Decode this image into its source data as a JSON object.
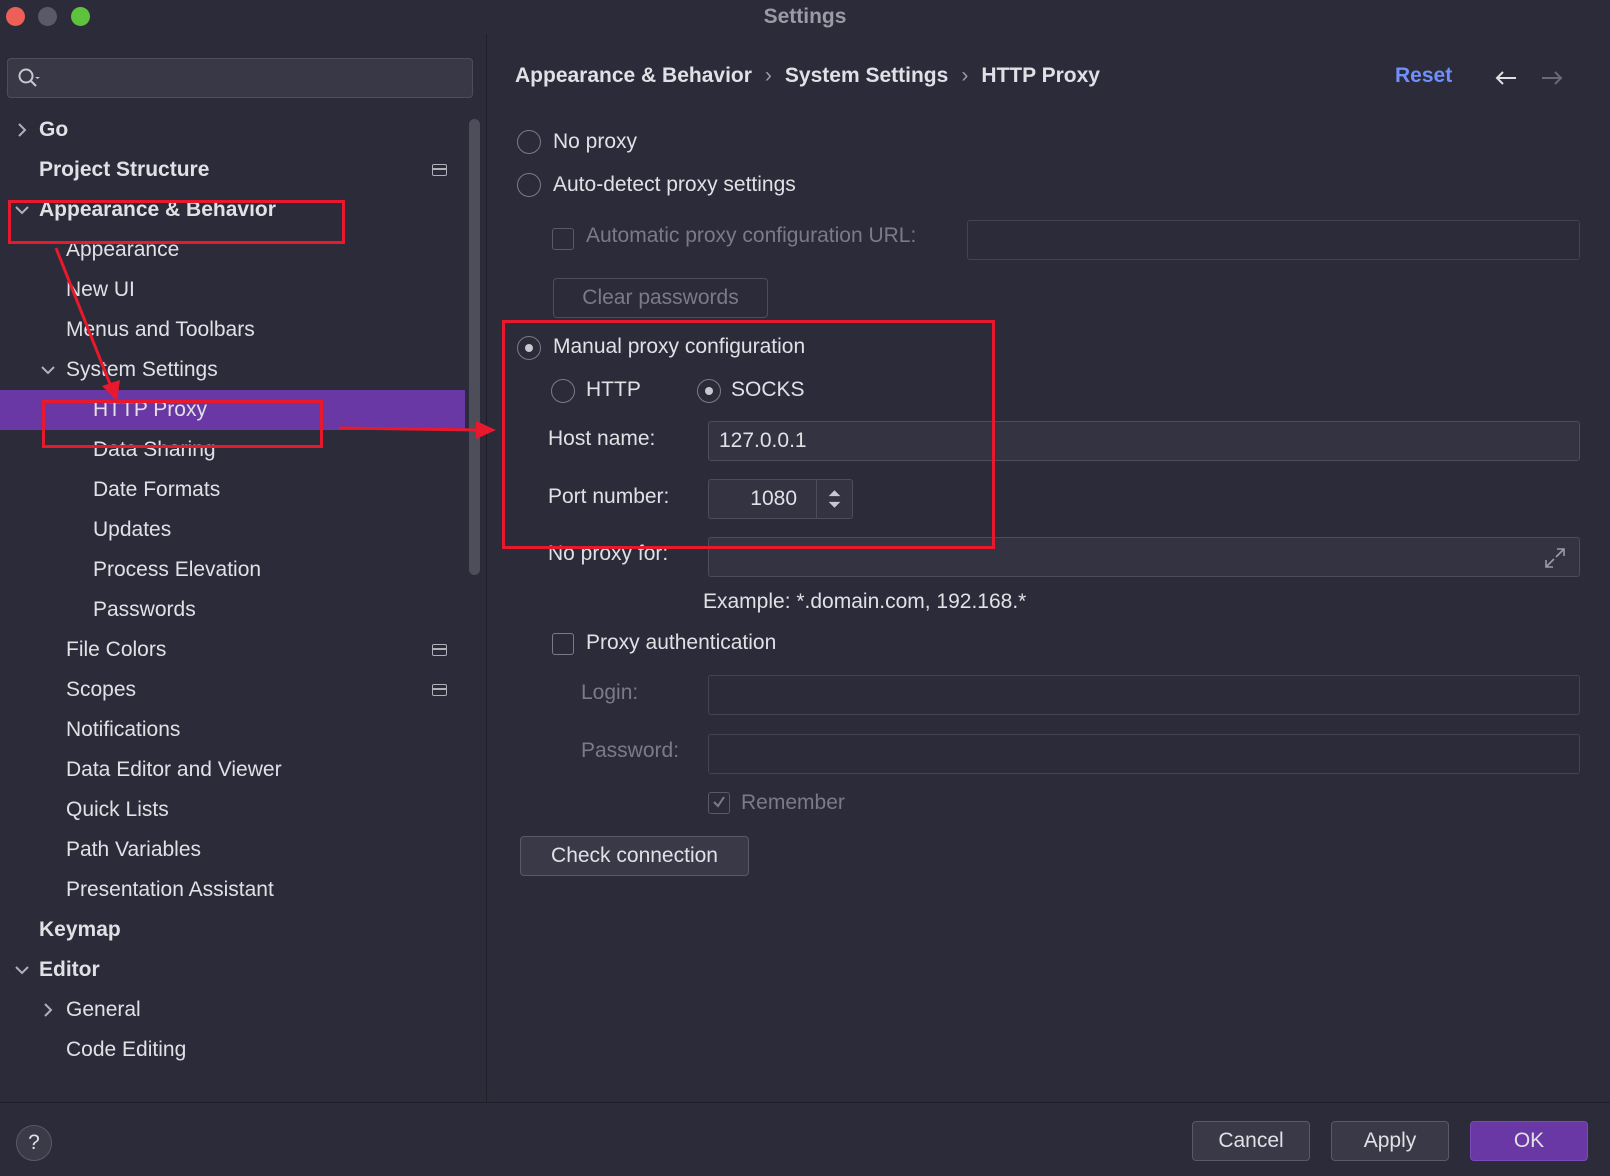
{
  "window": {
    "title": "Settings",
    "traffic_lights": [
      "close",
      "minimize",
      "maximize"
    ]
  },
  "sidebar": {
    "search_placeholder": "",
    "items": [
      {
        "label": "Go"
      },
      {
        "label": "Project Structure"
      },
      {
        "label": "Appearance & Behavior"
      },
      {
        "label": "Appearance"
      },
      {
        "label": "New UI"
      },
      {
        "label": "Menus and Toolbars"
      },
      {
        "label": "System Settings"
      },
      {
        "label": "HTTP Proxy"
      },
      {
        "label": "Data Sharing"
      },
      {
        "label": "Date Formats"
      },
      {
        "label": "Updates"
      },
      {
        "label": "Process Elevation"
      },
      {
        "label": "Passwords"
      },
      {
        "label": "File Colors"
      },
      {
        "label": "Scopes"
      },
      {
        "label": "Notifications"
      },
      {
        "label": "Data Editor and Viewer"
      },
      {
        "label": "Quick Lists"
      },
      {
        "label": "Path Variables"
      },
      {
        "label": "Presentation Assistant"
      },
      {
        "label": "Keymap"
      },
      {
        "label": "Editor"
      },
      {
        "label": "General"
      },
      {
        "label": "Code Editing"
      }
    ],
    "selected": "HTTP Proxy"
  },
  "header": {
    "breadcrumb": [
      "Appearance & Behavior",
      "System Settings",
      "HTTP Proxy"
    ],
    "separator": "›",
    "reset_label": "Reset"
  },
  "proxy": {
    "no_proxy_label": "No proxy",
    "auto_detect_label": "Auto-detect proxy settings",
    "auto_url_label": "Automatic proxy configuration URL:",
    "auto_url_value": "",
    "clear_passwords_label": "Clear passwords",
    "manual_label": "Manual proxy configuration",
    "selected_mode": "Manual proxy configuration",
    "http_label": "HTTP",
    "socks_label": "SOCKS",
    "selected_type": "SOCKS",
    "host_label": "Host name:",
    "host_value": "127.0.0.1",
    "port_label": "Port number:",
    "port_value": "1080",
    "no_proxy_for_label": "No proxy for:",
    "no_proxy_for_value": "",
    "example_text": "Example: *.domain.com, 192.168.*",
    "auth_label": "Proxy authentication",
    "auth_checked": false,
    "login_label": "Login:",
    "login_value": "",
    "password_label": "Password:",
    "password_value": "",
    "remember_label": "Remember",
    "remember_checked": true,
    "check_connection_label": "Check connection"
  },
  "footer": {
    "help_label": "?",
    "cancel_label": "Cancel",
    "apply_label": "Apply",
    "ok_label": "OK"
  },
  "colors": {
    "background": "#2b2b3a",
    "selection": "#6a38a4",
    "link": "#6f8ffb",
    "annotation": "#e8192c"
  }
}
